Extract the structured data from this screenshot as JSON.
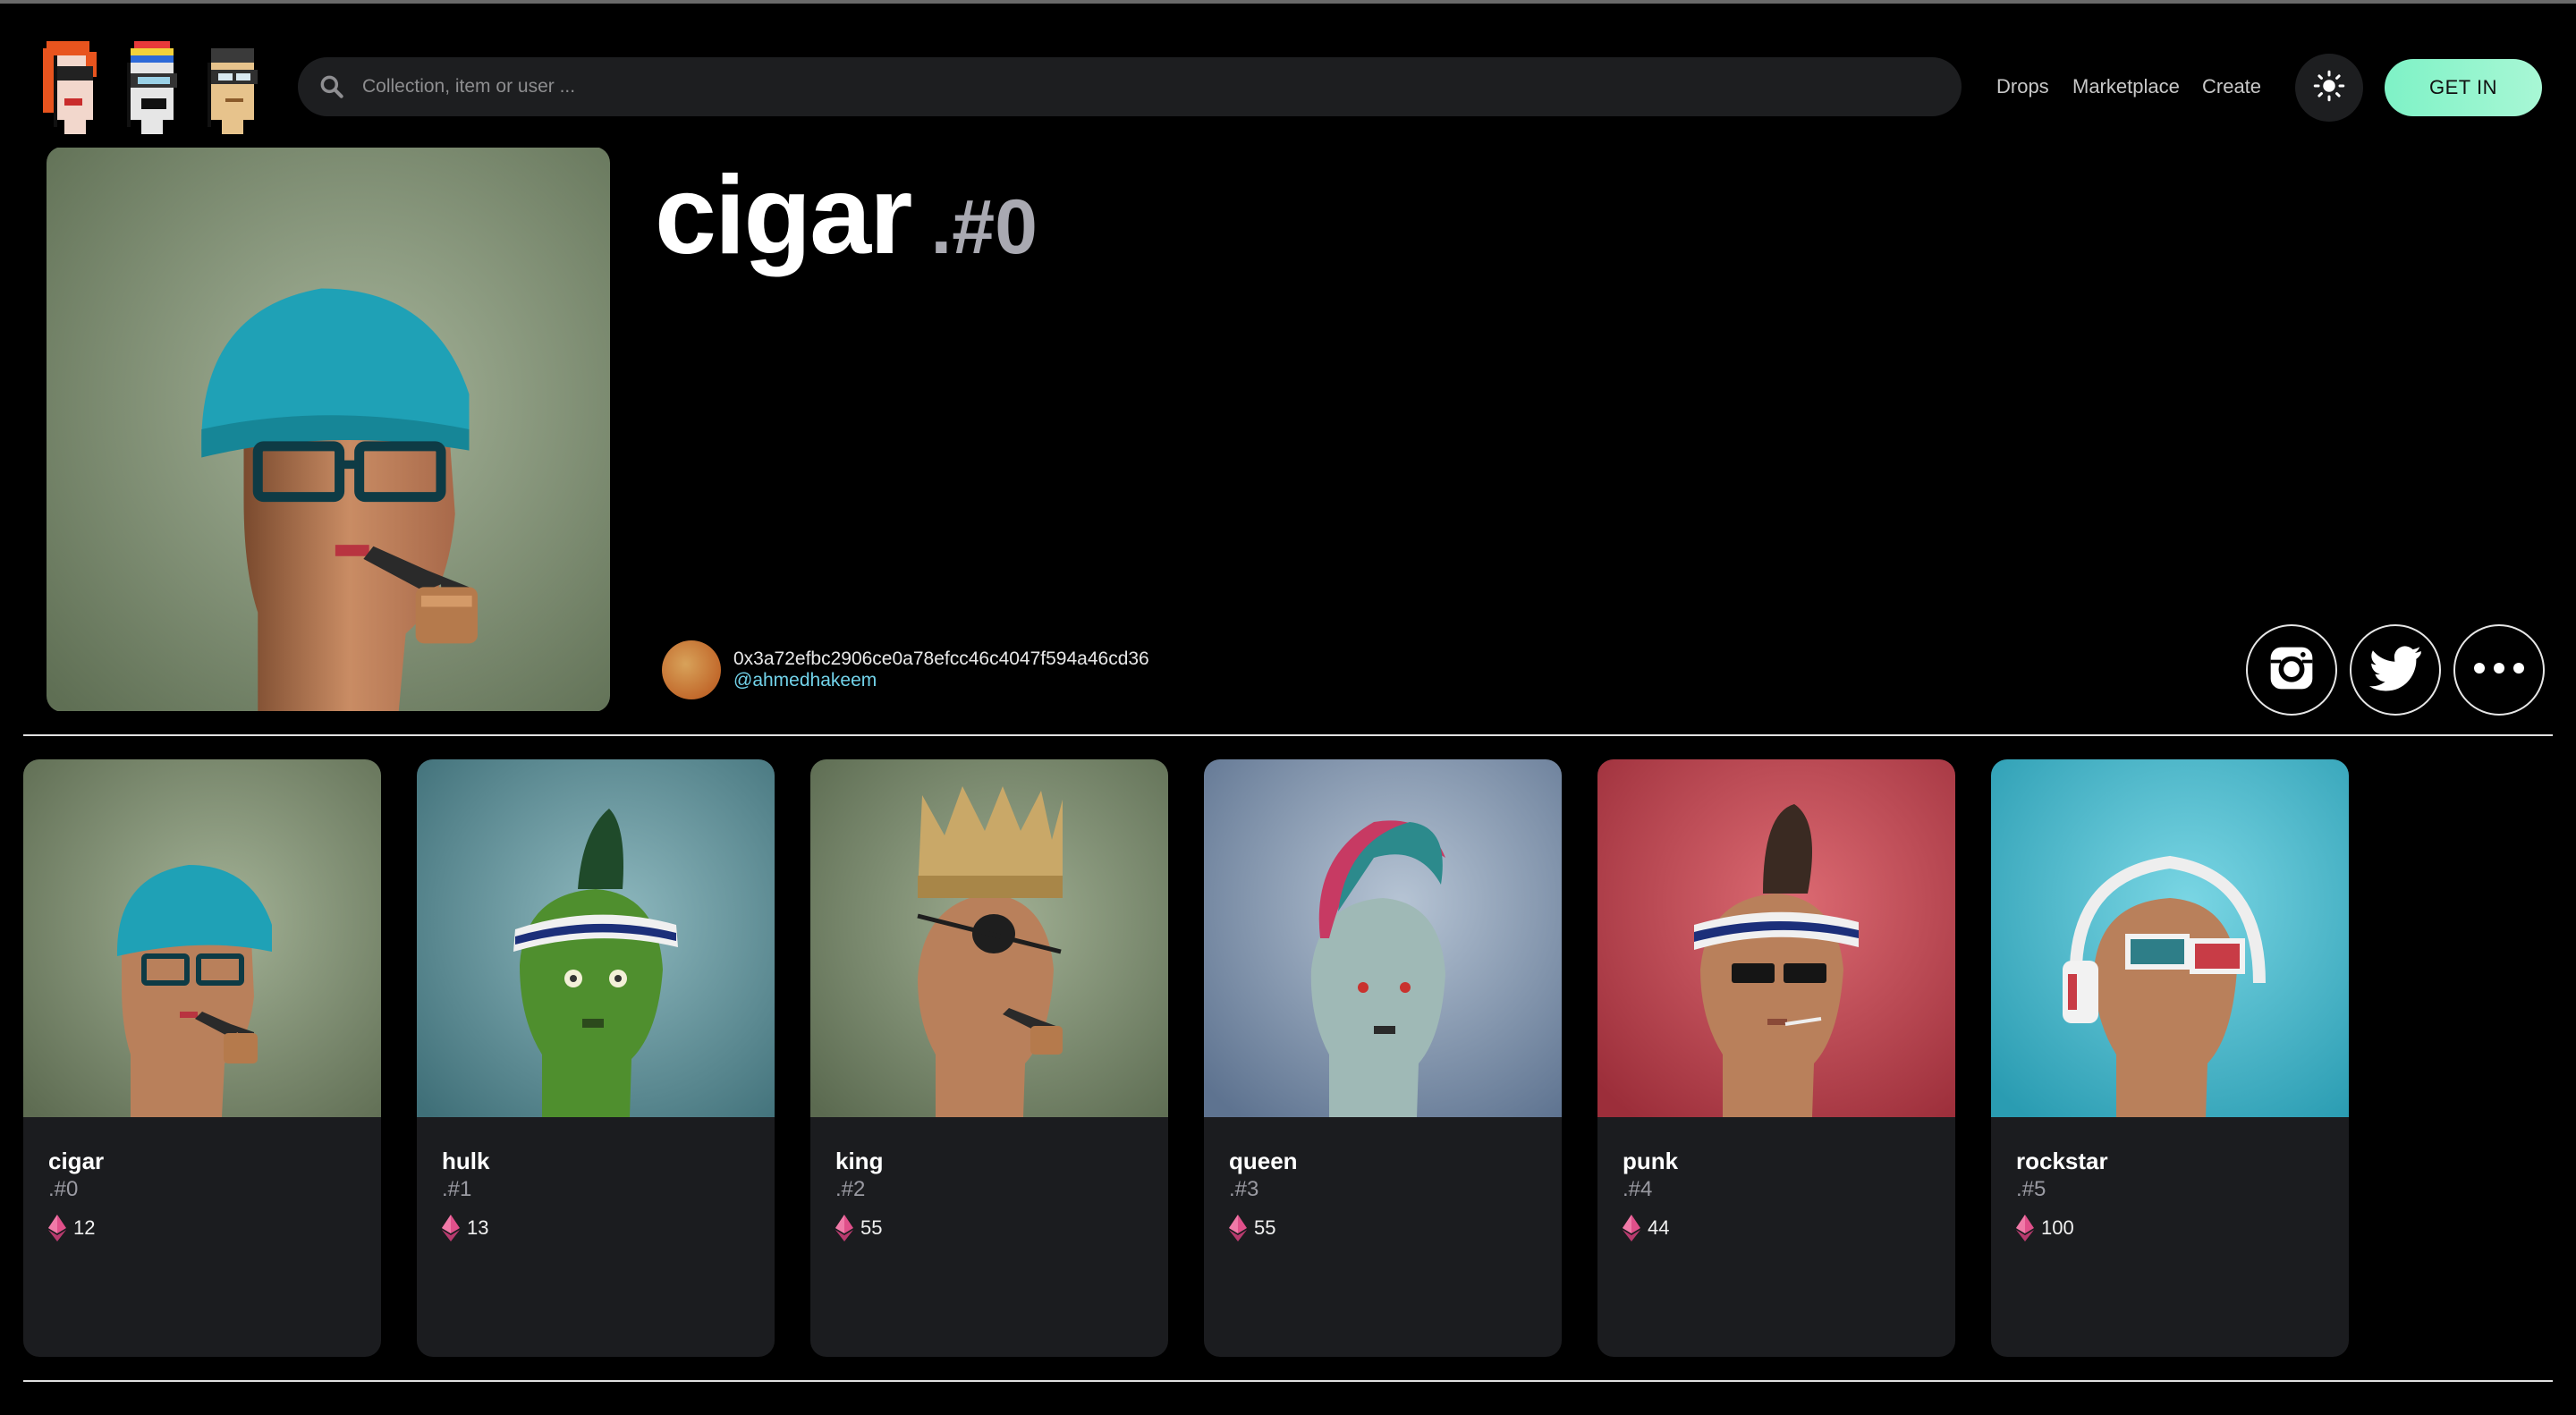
{
  "header": {
    "search_placeholder": "Collection, item or user ...",
    "nav": [
      "Drops",
      "Marketplace",
      "Create"
    ],
    "cta": "GET IN"
  },
  "hero": {
    "name": "cigar",
    "number": ".#0",
    "owner_address": "0x3a72efbc2906ce0a78efcc46c4047f594a46cd36",
    "owner_handle": "@ahmedhakeem"
  },
  "cards": [
    {
      "name": "cigar",
      "number": ".#0",
      "price": "12"
    },
    {
      "name": "hulk",
      "number": ".#1",
      "price": "13"
    },
    {
      "name": "king",
      "number": ".#2",
      "price": "55"
    },
    {
      "name": "queen",
      "number": ".#3",
      "price": "55"
    },
    {
      "name": "punk",
      "number": ".#4",
      "price": "44"
    },
    {
      "name": "rockstar",
      "number": ".#5",
      "price": "100"
    }
  ],
  "colors": {
    "accent": "#7ef2c6",
    "handle": "#72d3ea",
    "card_bg": "#1b1c1f",
    "eth_icon": "#e0508a"
  },
  "icons": [
    "search-icon",
    "sun-icon",
    "instagram-icon",
    "twitter-icon",
    "more-icon",
    "eth-icon"
  ]
}
